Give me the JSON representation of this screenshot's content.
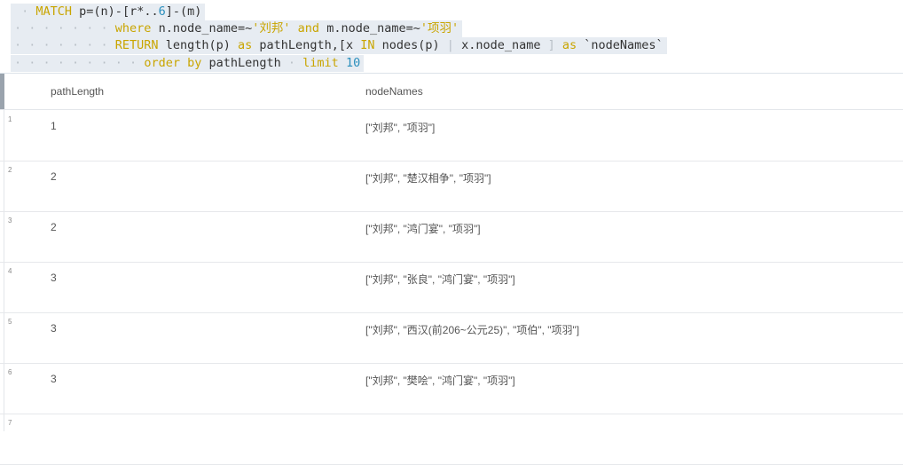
{
  "editor": {
    "lines": [
      [
        {
          "t": " · ",
          "c": "dot"
        },
        {
          "t": "MATCH",
          "c": "kw"
        },
        {
          "t": " ",
          "c": "dot"
        },
        {
          "t": "p=(n)-[r*..",
          "c": "id"
        },
        {
          "t": "6",
          "c": "num"
        },
        {
          "t": "]-(m)",
          "c": "id"
        }
      ],
      [
        {
          "t": "· · · · · · · ",
          "c": "dot"
        },
        {
          "t": "where",
          "c": "kw"
        },
        {
          "t": " ",
          "c": "dot"
        },
        {
          "t": "n.node_name=~",
          "c": "id"
        },
        {
          "t": "'刘邦'",
          "c": "str"
        },
        {
          "t": " ",
          "c": "dot"
        },
        {
          "t": "and",
          "c": "kw"
        },
        {
          "t": " ",
          "c": "dot"
        },
        {
          "t": "m.node_name=~",
          "c": "id"
        },
        {
          "t": "'项羽'",
          "c": "str"
        }
      ],
      [
        {
          "t": "· · · · · · · ",
          "c": "dot"
        },
        {
          "t": "RETURN",
          "c": "kw"
        },
        {
          "t": " ",
          "c": "dot"
        },
        {
          "t": "length(p)",
          "c": "id"
        },
        {
          "t": " ",
          "c": "dot"
        },
        {
          "t": "as",
          "c": "kw"
        },
        {
          "t": " ",
          "c": "dot"
        },
        {
          "t": "pathLength,[x",
          "c": "id"
        },
        {
          "t": " ",
          "c": "dot"
        },
        {
          "t": "IN",
          "c": "kw"
        },
        {
          "t": " ",
          "c": "dot"
        },
        {
          "t": "nodes(p)",
          "c": "id"
        },
        {
          "t": " | ",
          "c": "dot"
        },
        {
          "t": "x.node_name",
          "c": "id"
        },
        {
          "t": " ] ",
          "c": "dot"
        },
        {
          "t": "as",
          "c": "kw"
        },
        {
          "t": " ",
          "c": "dot"
        },
        {
          "t": "`nodeNames`",
          "c": "id"
        }
      ],
      [
        {
          "t": "· · · · · · · · · ",
          "c": "dot"
        },
        {
          "t": "order",
          "c": "kw"
        },
        {
          "t": " ",
          "c": "dot"
        },
        {
          "t": "by",
          "c": "kw"
        },
        {
          "t": " ",
          "c": "dot"
        },
        {
          "t": "pathLength",
          "c": "id"
        },
        {
          "t": " · ",
          "c": "dot"
        },
        {
          "t": "limit",
          "c": "kw"
        },
        {
          "t": " ",
          "c": "dot"
        },
        {
          "t": "10",
          "c": "num"
        }
      ]
    ]
  },
  "table": {
    "columns": [
      "pathLength",
      "nodeNames"
    ],
    "rows": [
      {
        "num": "1",
        "pathLength": "1",
        "nodeNames": "[\"刘邦\", \"项羽\"]"
      },
      {
        "num": "2",
        "pathLength": "2",
        "nodeNames": "[\"刘邦\", \"楚汉相争\", \"项羽\"]"
      },
      {
        "num": "3",
        "pathLength": "2",
        "nodeNames": "[\"刘邦\", \"鸿门宴\", \"项羽\"]"
      },
      {
        "num": "4",
        "pathLength": "3",
        "nodeNames": "[\"刘邦\", \"张良\", \"鸿门宴\", \"项羽\"]"
      },
      {
        "num": "5",
        "pathLength": "3",
        "nodeNames": "[\"刘邦\", \"西汉(前206~公元25)\", \"项伯\", \"项羽\"]"
      },
      {
        "num": "6",
        "pathLength": "3",
        "nodeNames": "[\"刘邦\", \"樊哙\", \"鸿门宴\", \"项羽\"]"
      },
      {
        "num": "7",
        "pathLength": "",
        "nodeNames": ""
      }
    ]
  }
}
